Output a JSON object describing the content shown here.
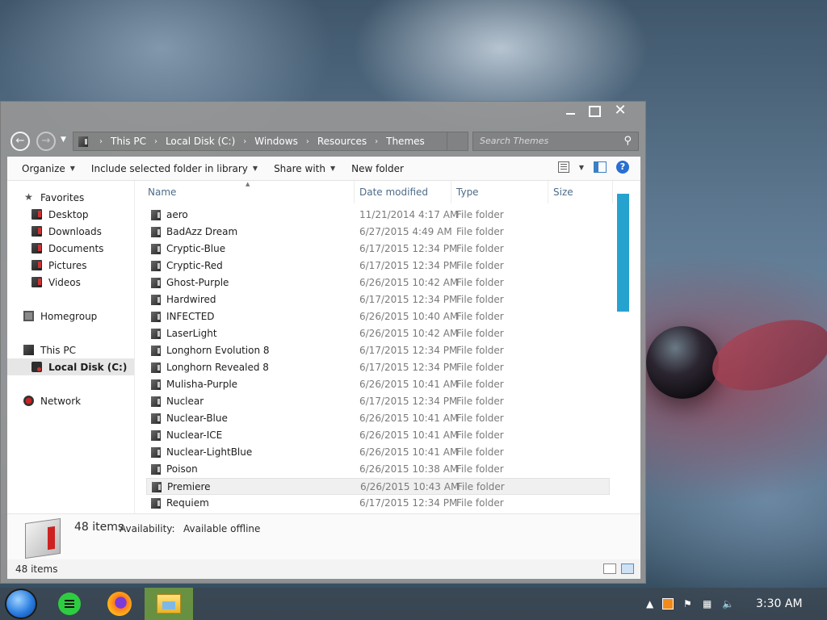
{
  "breadcrumb": [
    "This PC",
    "Local Disk (C:)",
    "Windows",
    "Resources",
    "Themes"
  ],
  "search": {
    "placeholder": "Search Themes"
  },
  "toolbar": {
    "organize": "Organize",
    "include": "Include selected folder in library",
    "share": "Share with",
    "new_folder": "New folder"
  },
  "nav": {
    "favorites": "Favorites",
    "desktop": "Desktop",
    "downloads": "Downloads",
    "documents": "Documents",
    "pictures": "Pictures",
    "videos": "Videos",
    "homegroup": "Homegroup",
    "this_pc": "This PC",
    "local_disk": "Local Disk (C:)",
    "network": "Network"
  },
  "columns": {
    "name": "Name",
    "date": "Date modified",
    "type": "Type",
    "size": "Size"
  },
  "files": [
    {
      "name": "aero",
      "date": "11/21/2014 4:17 AM",
      "type": "File folder"
    },
    {
      "name": "BadAzz Dream",
      "date": "6/27/2015 4:49 AM",
      "type": "File folder"
    },
    {
      "name": "Cryptic-Blue",
      "date": "6/17/2015 12:34 PM",
      "type": "File folder"
    },
    {
      "name": "Cryptic-Red",
      "date": "6/17/2015 12:34 PM",
      "type": "File folder"
    },
    {
      "name": "Ghost-Purple",
      "date": "6/26/2015 10:42 AM",
      "type": "File folder"
    },
    {
      "name": "Hardwired",
      "date": "6/17/2015 12:34 PM",
      "type": "File folder"
    },
    {
      "name": "INFECTED",
      "date": "6/26/2015 10:40 AM",
      "type": "File folder"
    },
    {
      "name": "LaserLight",
      "date": "6/26/2015 10:42 AM",
      "type": "File folder"
    },
    {
      "name": "Longhorn Evolution 8",
      "date": "6/17/2015 12:34 PM",
      "type": "File folder"
    },
    {
      "name": "Longhorn Revealed 8",
      "date": "6/17/2015 12:34 PM",
      "type": "File folder"
    },
    {
      "name": "Mulisha-Purple",
      "date": "6/26/2015 10:41 AM",
      "type": "File folder"
    },
    {
      "name": "Nuclear",
      "date": "6/17/2015 12:34 PM",
      "type": "File folder"
    },
    {
      "name": "Nuclear-Blue",
      "date": "6/26/2015 10:41 AM",
      "type": "File folder"
    },
    {
      "name": "Nuclear-ICE",
      "date": "6/26/2015 10:41 AM",
      "type": "File folder"
    },
    {
      "name": "Nuclear-LightBlue",
      "date": "6/26/2015 10:41 AM",
      "type": "File folder"
    },
    {
      "name": "Poison",
      "date": "6/26/2015 10:38 AM",
      "type": "File folder"
    },
    {
      "name": "Premiere",
      "date": "6/26/2015 10:43 AM",
      "type": "File folder"
    },
    {
      "name": "Requiem",
      "date": "6/17/2015 12:34 PM",
      "type": "File folder"
    }
  ],
  "details": {
    "count": "48 items",
    "availability_label": "Availability:",
    "availability_value": "Available offline"
  },
  "status": {
    "count": "48 items"
  },
  "clock": "3:30 AM",
  "colors": {
    "accent": "#26a2cf",
    "taskbar_active": "#78aa3c"
  }
}
